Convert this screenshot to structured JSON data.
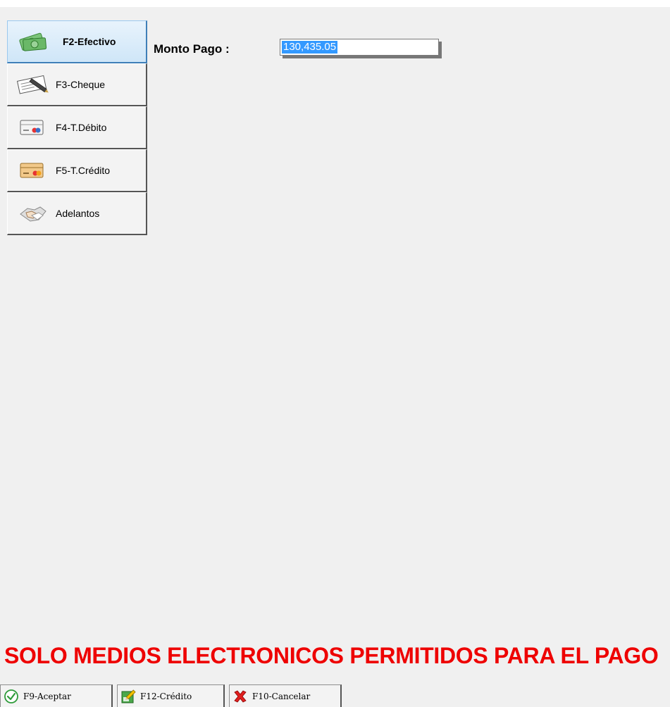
{
  "side_menu": {
    "items": [
      {
        "label": "F2-Efectivo",
        "icon": "cash-icon",
        "active": true
      },
      {
        "label": "F3-Cheque",
        "icon": "cheque-icon",
        "active": false
      },
      {
        "label": "F4-T.Débito",
        "icon": "debit-card-icon",
        "active": false
      },
      {
        "label": "F5-T.Crédito",
        "icon": "credit-card-icon",
        "active": false
      },
      {
        "label": "Adelantos",
        "icon": "handshake-icon",
        "active": false
      }
    ]
  },
  "payment": {
    "label": "Monto Pago :",
    "amount": "130,435.05"
  },
  "warning": {
    "text": "SOLO MEDIOS ELECTRONICOS PERMITIDOS PARA EL PAGO",
    "color": "#ee0000"
  },
  "bottom_buttons": {
    "accept_label": "F9-Aceptar",
    "credit_label": "F12-Crédito",
    "cancel_label": "F10-Cancelar"
  },
  "colors": {
    "selection": "#3399ff",
    "active_tab": "#cfe6f8"
  }
}
